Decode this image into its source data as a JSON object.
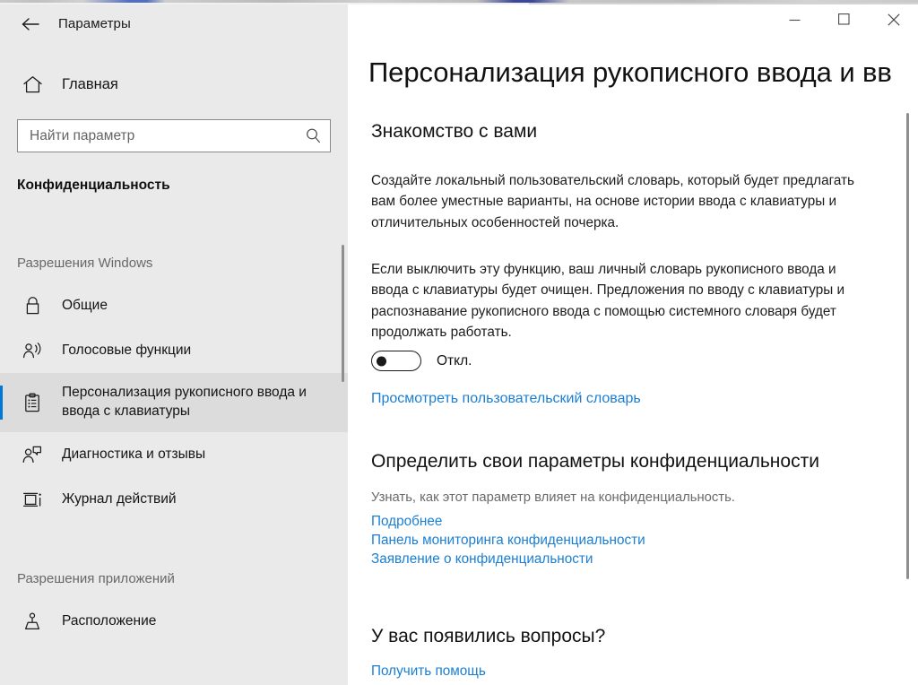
{
  "window": {
    "app_title": "Параметры",
    "back_icon": "back-arrow-icon",
    "controls": {
      "minimize": "minimize-icon",
      "maximize": "maximize-icon",
      "close": "close-icon"
    }
  },
  "sidebar": {
    "home": {
      "label": "Главная",
      "icon": "home-icon"
    },
    "search": {
      "placeholder": "Найти параметр",
      "value": "",
      "icon": "search-icon"
    },
    "category": "Конфиденциальность",
    "groups": [
      {
        "header": "Разрешения Windows",
        "items": [
          {
            "label": "Общие",
            "icon": "lock-icon",
            "selected": false
          },
          {
            "label": "Голосовые функции",
            "icon": "voice-person-icon",
            "selected": false
          },
          {
            "label": "Персонализация рукописного ввода и ввода с клавиатуры",
            "icon": "clipboard-icon",
            "selected": true
          },
          {
            "label": "Диагностика и отзывы",
            "icon": "feedback-person-icon",
            "selected": false
          },
          {
            "label": "Журнал действий",
            "icon": "timeline-icon",
            "selected": false
          }
        ]
      },
      {
        "header": "Разрешения приложений",
        "items": [
          {
            "label": "Расположение",
            "icon": "location-pin-icon",
            "selected": false
          }
        ]
      }
    ]
  },
  "main": {
    "page_title": "Персонализация рукописного ввода и вв",
    "sections": {
      "getting_to_know": {
        "heading": "Знакомство с вами",
        "paragraph_1": "Создайте локальный пользовательский словарь, который будет предлагать вам более уместные варианты, на основе истории ввода с клавиатуры и отличительных особенностей почерка.",
        "paragraph_2": "Если выключить эту функцию, ваш личный словарь рукописного ввода и ввода с клавиатуры будет очищен. Предложения по вводу с клавиатуры и распознавание рукописного ввода с помощью системного словаря будет продолжать работать.",
        "toggle": {
          "state_label": "Откл.",
          "checked": false
        },
        "dictionary_link": "Просмотреть пользовательский словарь"
      },
      "privacy": {
        "heading": "Определить свои параметры конфиденциальности",
        "note": "Узнать, как этот параметр влияет на конфиденциальность.",
        "links": [
          "Подробнее",
          "Панель мониторинга конфиденциальности",
          "Заявление о конфиденциальности"
        ]
      },
      "questions": {
        "heading": "У вас появились вопросы?",
        "link": "Получить помощь"
      }
    }
  },
  "colors": {
    "accent": "#0078d7",
    "link": "#1a7fd4",
    "sidebar_bg": "#eaeaea",
    "content_bg": "#ffffff",
    "selected_bg": "#dcdcdc"
  }
}
